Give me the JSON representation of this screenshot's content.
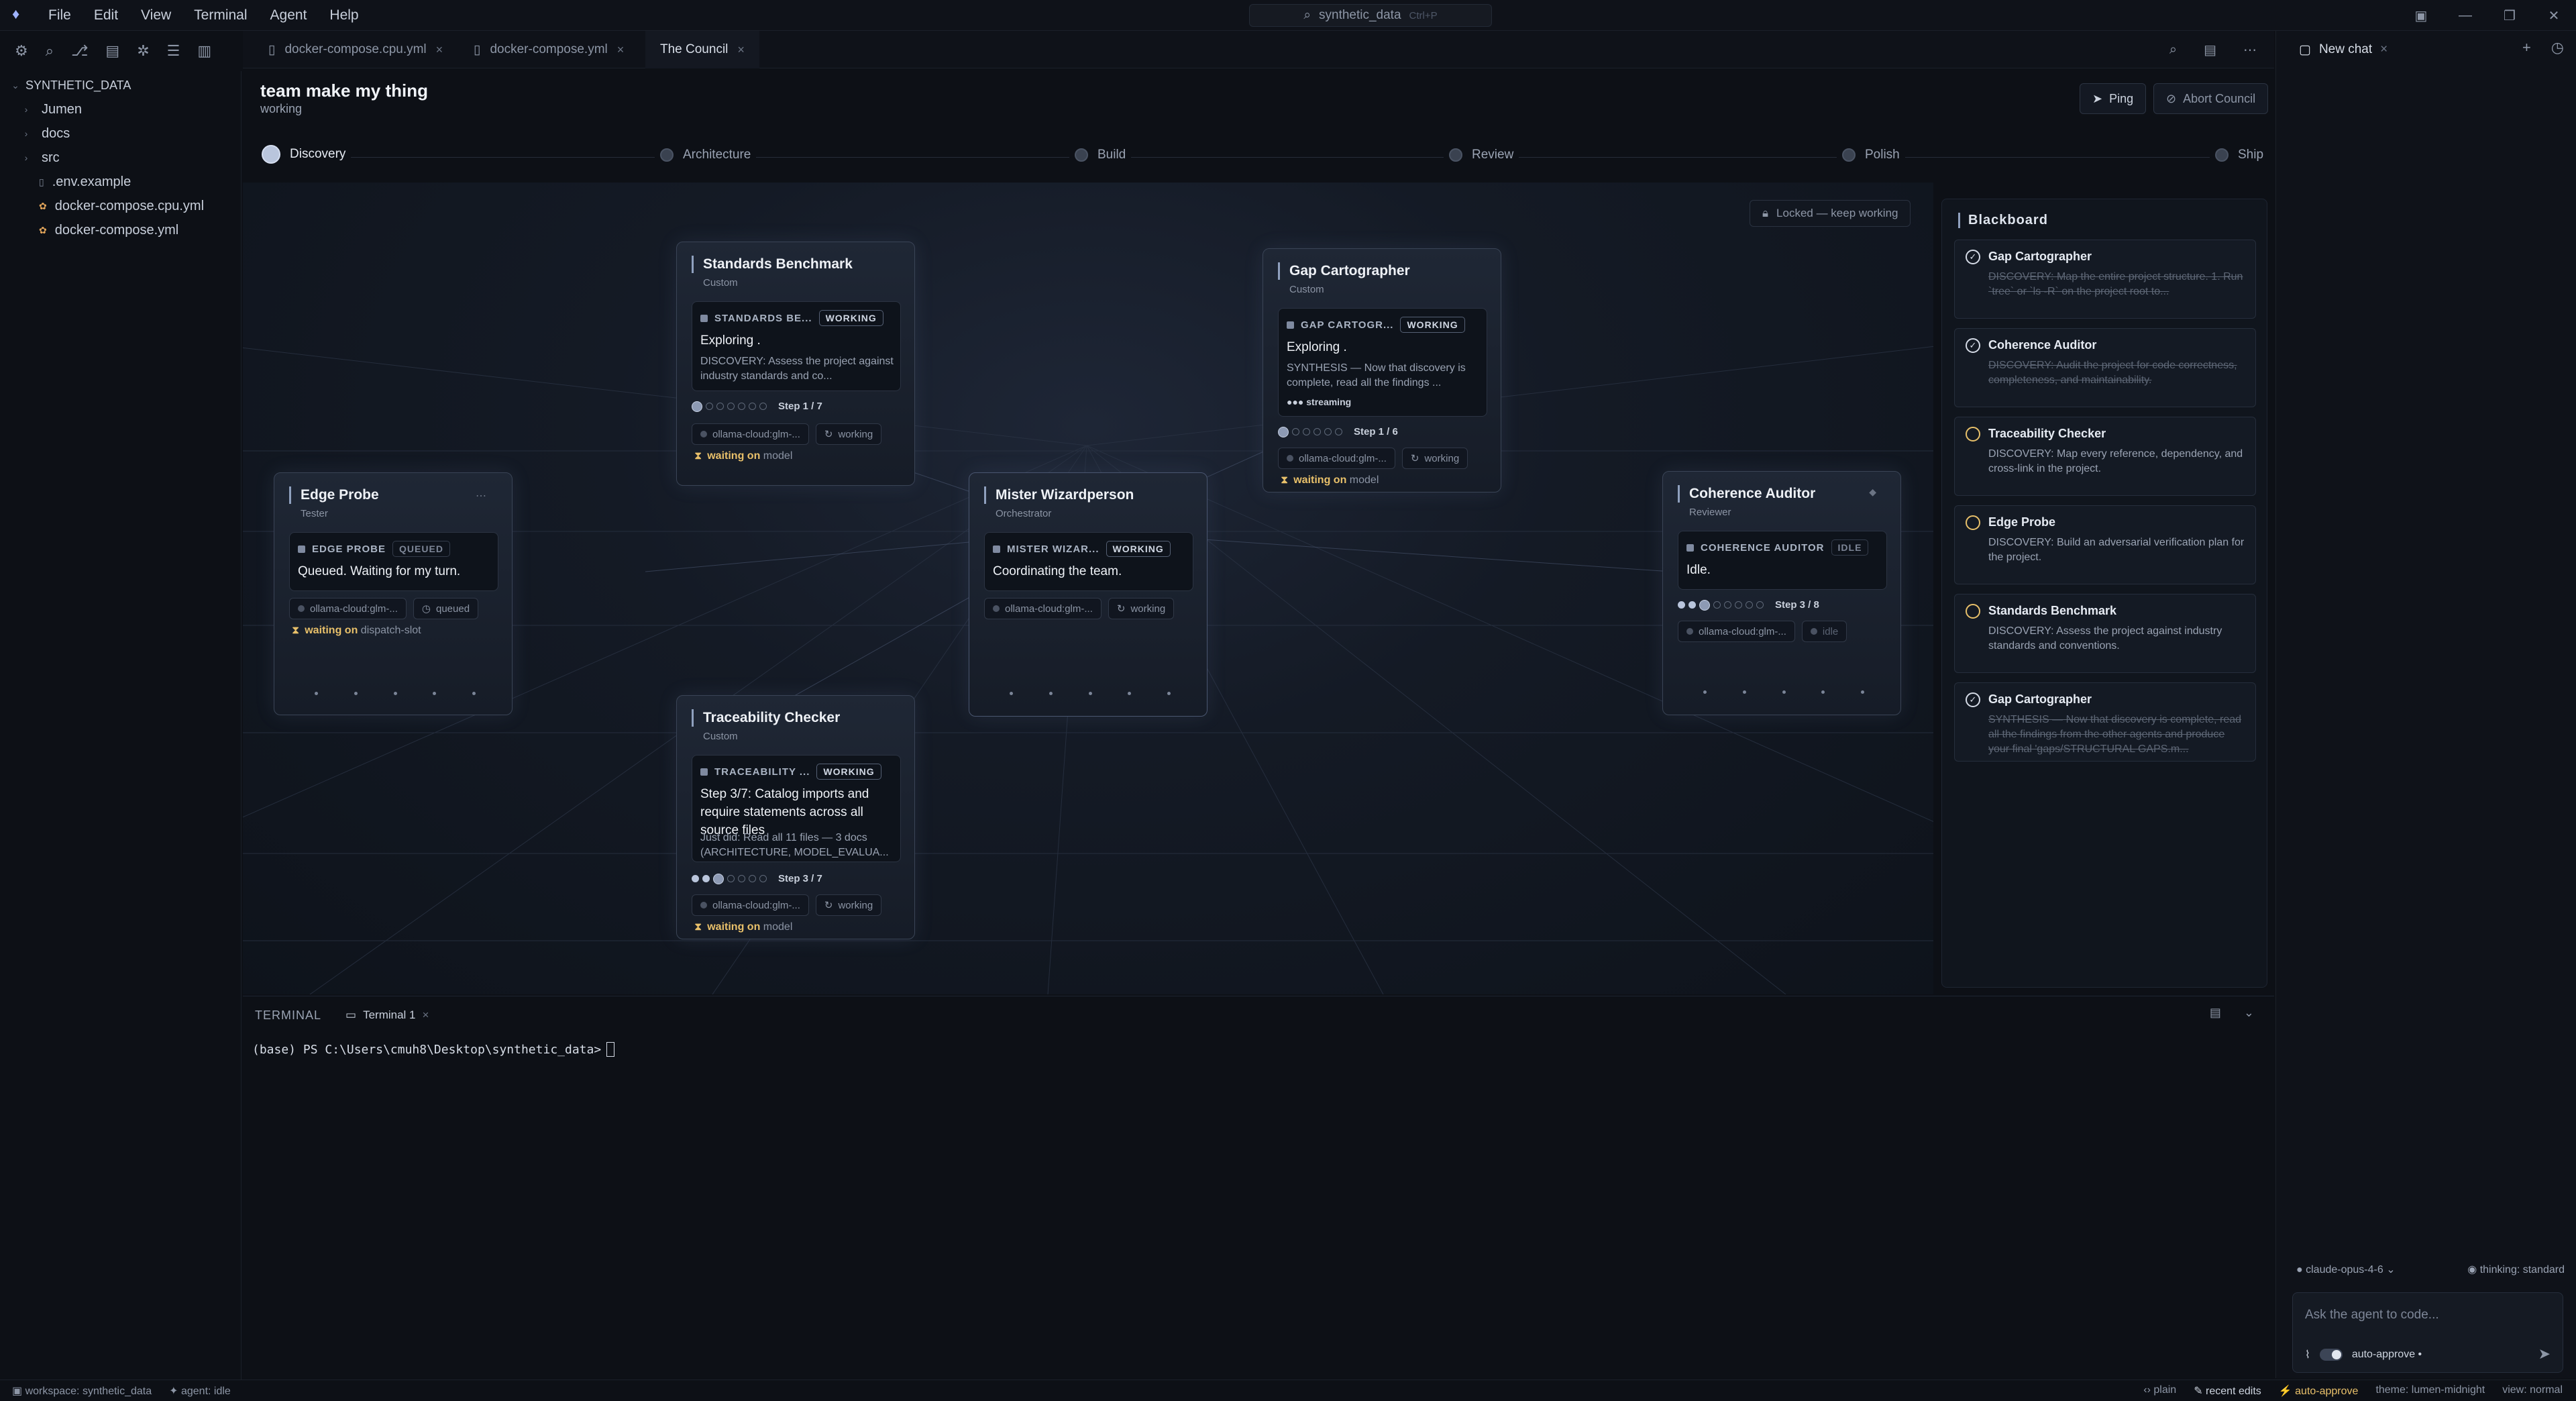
{
  "menu": [
    "File",
    "Edit",
    "View",
    "Terminal",
    "Agent",
    "Help"
  ],
  "command_search": {
    "label": "synthetic_data",
    "shortcut": "Ctrl+P"
  },
  "explorer": {
    "root": "SYNTHETIC_DATA",
    "items": [
      {
        "name": "Jumen",
        "kind": "folder"
      },
      {
        "name": "docs",
        "kind": "folder"
      },
      {
        "name": "src",
        "kind": "folder"
      },
      {
        "name": ".env.example",
        "kind": "file"
      },
      {
        "name": "docker-compose.cpu.yml",
        "kind": "config"
      },
      {
        "name": "docker-compose.yml",
        "kind": "config"
      }
    ]
  },
  "tabs": [
    "docker-compose.cpu.yml",
    "docker-compose.yml",
    "The Council"
  ],
  "council": {
    "title": "team make my thing",
    "status": "working",
    "ping_label": "Ping",
    "abort_label": "Abort Council",
    "lock_label": "Locked — keep working"
  },
  "phases": [
    "Discovery",
    "Architecture",
    "Build",
    "Review",
    "Polish",
    "Ship"
  ],
  "active_phase": "Discovery",
  "agents": {
    "standards": {
      "name": "Standards Benchmark",
      "role": "Custom",
      "tag": "STANDARDS BE...",
      "badge": "WORKING",
      "activity": "Exploring .",
      "desc": "DISCOVERY: Assess the project against industry standards and co...",
      "step": "Step 1 / 7",
      "step_done": 1,
      "step_total": 7,
      "model": "ollama-cloud:glm-...",
      "state": "working",
      "waiting_label": "waiting on",
      "waiting_on": "model"
    },
    "gap": {
      "name": "Gap Cartographer",
      "role": "Custom",
      "tag": "GAP CARTOGR...",
      "badge": "WORKING",
      "activity": "Exploring .",
      "desc": "SYNTHESIS — Now that discovery is complete, read all the findings ...",
      "stream": "streaming",
      "step": "Step 1 / 6",
      "step_done": 1,
      "step_total": 6,
      "model": "ollama-cloud:glm-...",
      "state": "working",
      "waiting_label": "waiting on",
      "waiting_on": "model"
    },
    "edge": {
      "name": "Edge Probe",
      "role": "Tester",
      "tag": "EDGE PROBE",
      "badge": "QUEUED",
      "activity": "Queued. Waiting for my turn.",
      "model": "ollama-cloud:glm-...",
      "state": "queued",
      "waiting_label": "waiting on",
      "waiting_on": "dispatch-slot"
    },
    "wizard": {
      "name": "Mister Wizardperson",
      "role": "Orchestrator",
      "tag": "MISTER WIZAR...",
      "badge": "WORKING",
      "activity": "Coordinating the team.",
      "model": "ollama-cloud:glm-...",
      "state": "working"
    },
    "auditor": {
      "name": "Coherence Auditor",
      "role": "Reviewer",
      "tag": "COHERENCE AUDITOR",
      "badge": "IDLE",
      "activity": "Idle.",
      "step": "Step 3 / 8",
      "step_done": 3,
      "step_total": 8,
      "model": "ollama-cloud:glm-...",
      "state": "idle"
    },
    "trace": {
      "name": "Traceability Checker",
      "role": "Custom",
      "tag": "TRACEABILITY ...",
      "badge": "WORKING",
      "activity": "Step 3/7: Catalog imports and require statements across all source files",
      "desc": "Just did: Read all 11 files — 3 docs (ARCHITECTURE, MODEL_EVALUA...",
      "step": "Step 3 / 7",
      "step_done": 3,
      "step_total": 7,
      "model": "ollama-cloud:glm-...",
      "state": "working",
      "waiting_label": "waiting on",
      "waiting_on": "model"
    }
  },
  "blackboard": {
    "title": "Blackboard",
    "items": [
      {
        "agent": "Gap Cartographer",
        "text": "DISCOVERY: Map the entire project structure. 1. Run `tree` or `ls -R` on the project root to...",
        "done": true
      },
      {
        "agent": "Coherence Auditor",
        "text": "DISCOVERY: Audit the project for code correctness, completeness, and maintainability.",
        "done": true
      },
      {
        "agent": "Traceability Checker",
        "text": "DISCOVERY: Map every reference, dependency, and cross-link in the project.",
        "done": false
      },
      {
        "agent": "Edge Probe",
        "text": "DISCOVERY: Build an adversarial verification plan for the project.",
        "done": false
      },
      {
        "agent": "Standards Benchmark",
        "text": "DISCOVERY: Assess the project against industry standards and conventions.",
        "done": false
      },
      {
        "agent": "Gap Cartographer",
        "text": "SYNTHESIS — Now that discovery is complete, read all the findings from the other agents and produce your final 'gaps/STRUCTURAL GAPS.m...",
        "done": true
      }
    ]
  },
  "terminal": {
    "label": "TERMINAL",
    "tab": "Terminal 1",
    "prompt": "(base) PS C:\\Users\\cmuh8\\Desktop\\synthetic_data>"
  },
  "chat": {
    "tab": "New chat",
    "model": "claude-opus-4-6",
    "thinking": "thinking: standard",
    "placeholder": "Ask the agent to code...",
    "auto_approve": "auto-approve •"
  },
  "statusbar": {
    "workspace": "workspace: synthetic_data",
    "agent": "agent: idle",
    "mode": "plain",
    "recent": "recent edits",
    "approve": "auto-approve",
    "theme": "theme: lumen-midnight",
    "view": "view: normal"
  }
}
